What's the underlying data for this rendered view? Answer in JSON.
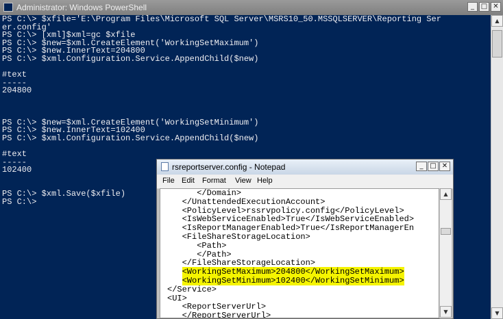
{
  "powershell": {
    "title": "Administrator: Windows PowerShell",
    "console_lines": [
      "PS C:\\> $xfile='E:\\Program Files\\Microsoft SQL Server\\MSRS10_50.MSSQLSERVER\\Reporting Ser",
      "er.config'",
      "PS C:\\> [xml]$xml=gc $xfile",
      "PS C:\\> $new=$xml.CreateElement('WorkingSetMaximum')",
      "PS C:\\> $new.InnerText=204800",
      "PS C:\\> $xml.Configuration.Service.AppendChild($new)",
      "",
      "#text",
      "-----",
      "204800",
      "",
      "",
      "",
      "PS C:\\> $new=$xml.CreateElement('WorkingSetMinimum')",
      "PS C:\\> $new.InnerText=102400",
      "PS C:\\> $xml.Configuration.Service.AppendChild($new)",
      "",
      "#text",
      "-----",
      "102400",
      "",
      "",
      "PS C:\\> $xml.Save($xfile)",
      "PS C:\\>"
    ]
  },
  "notepad": {
    "title": "rsreportserver.config - Notepad",
    "menu": [
      "File",
      "Edit",
      "Format",
      "View",
      "Help"
    ],
    "lines": [
      "      </Domain>",
      "   </UnattendedExecutionAccount>",
      "   <PolicyLevel>rssrvpolicy.config</PolicyLevel>",
      "   <IsWebServiceEnabled>True</IsWebServiceEnabled>",
      "   <IsReportManagerEnabled>True</IsReportManagerEn",
      "   <FileShareStorageLocation>",
      "      <Path>",
      "      </Path>",
      "   </FileShareStorageLocation>",
      "   <WorkingSetMaximum>204800</WorkingSetMaximum>",
      "   <WorkingSetMinimum>102400</WorkingSetMinimum>",
      "</Service>",
      "<UI>",
      "   <ReportServerUrl>",
      "   </ReportServerUrl>"
    ],
    "highlighted_lines": [
      9,
      10
    ]
  },
  "colors": {
    "console_bg": "#012456",
    "console_fg": "#eeedf0",
    "highlight": "#f5f400"
  }
}
